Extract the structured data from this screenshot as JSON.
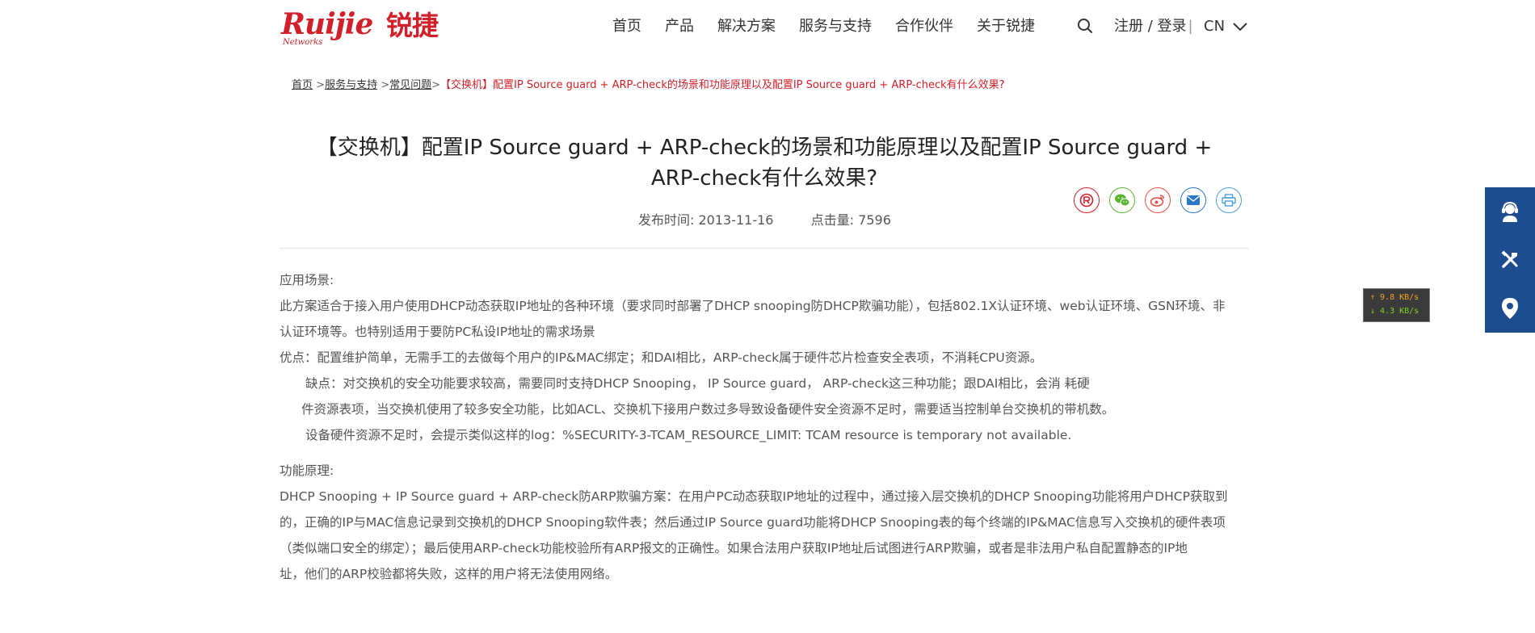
{
  "header": {
    "logo": {
      "en": "Ruijie",
      "cn": "锐捷",
      "sub": "Networks"
    },
    "nav": [
      "首页",
      "产品",
      "解决方案",
      "服务与支持",
      "合作伙伴",
      "关于锐捷"
    ],
    "login": "注册 / 登录",
    "login_sep": "|",
    "lang": "CN"
  },
  "breadcrumb": {
    "items": [
      "首页",
      "服务与支持",
      "常见问题"
    ],
    "sep": ">",
    "current": "【交换机】配置IP Source guard + ARP-check的场景和功能原理以及配置IP Source guard + ARP-check有什么效果?"
  },
  "article": {
    "title_line1": "【交换机】配置IP Source guard + ARP-check的场景和功能原理以及配置IP Source guard +",
    "title_line2": "ARP-check有什么效果?",
    "date_label": "发布时间:",
    "date": "2013-11-16",
    "views_label": "点击量:",
    "views": "7596",
    "lines": [
      "应用场景:",
      "此方案适合于接入用户使用DHCP动态获取IP地址的各种环境（要求同时部署了DHCP snooping防DHCP欺骗功能），包括802.1X认证环境、web认证环境、GSN环境、非",
      "认证环境等。也特别适用于要防PC私设IP地址的需求场景",
      "优点：配置维护简单，无需手工的去做每个用户的IP&MAC绑定；和DAI相比，ARP-check属于硬件芯片检查安全表项，不消耗CPU资源。",
      "缺点：对交换机的安全功能要求较高，需要同时支持DHCP Snooping， IP Source guard， ARP-check这三种功能；跟DAI相比，会消        耗硬",
      "件资源表项，当交换机使用了较多安全功能，比如ACL、交换机下接用户数过多导致设备硬件安全资源不足时，需要适当控制单台交换机的带机数。",
      "设备硬件资源不足时，会提示类似这样的log：%SECURITY-3-TCAM_RESOURCE_LIMIT: TCAM resource is temporary not available.",
      "功能原理:",
      "DHCP Snooping + IP Source guard + ARP-check防ARP欺骗方案：在用户PC动态获取IP地址的过程中，通过接入层交换机的DHCP Snooping功能将用户DHCP获取到",
      "的，正确的IP与MAC信息记录到交换机的DHCP Snooping软件表；然后通过IP Source guard功能将DHCP Snooping表的每个终端的IP&MAC信息写入交换机的硬件表项",
      "（类似端口安全的绑定）；最后使用ARP-check功能校验所有ARP报文的正确性。如果合法用户获取IP地址后试图进行ARP欺骗，或者是非法用户私自配置静态的IP地",
      "址，他们的ARP校验都将失败，这样的用户将无法使用网络。"
    ]
  },
  "speed": {
    "up": "↑ 9.8 KB/s",
    "down": "↓ 4.3 KB/s"
  },
  "colors": {
    "brand": "#d2202a",
    "sidebar": "#1e4d8f"
  }
}
